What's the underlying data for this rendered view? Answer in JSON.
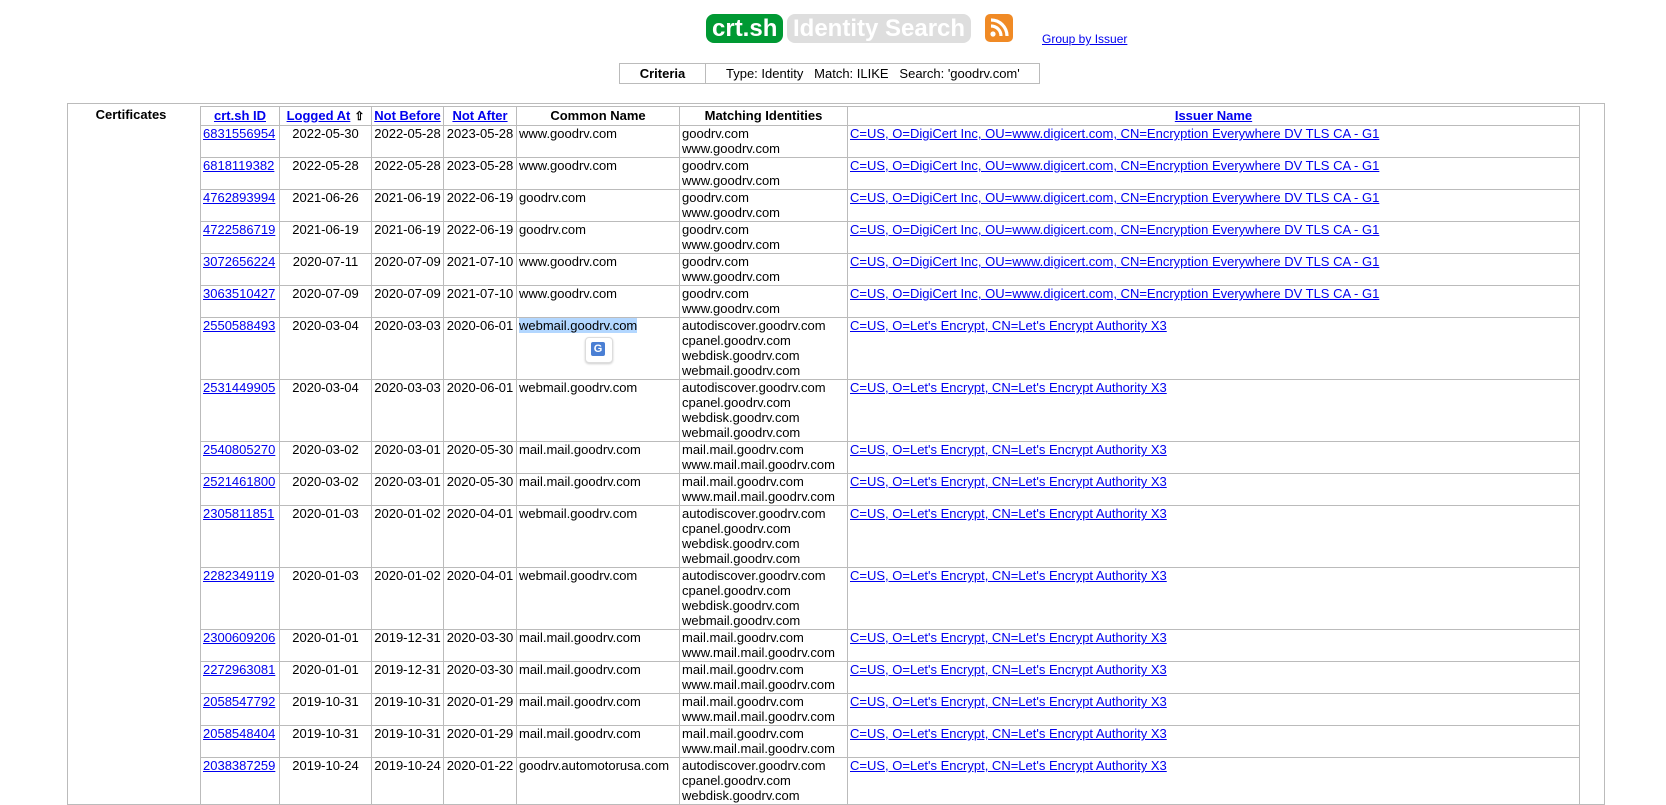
{
  "header": {
    "logo": "crt.sh",
    "title": "Identity Search",
    "rss_icon": "rss-feed-icon",
    "group_by_link": "Group by Issuer"
  },
  "criteria": {
    "label": "Criteria",
    "value": "Type: Identity   Match: ILIKE   Search: 'goodrv.com'"
  },
  "certificates_label": "Certificates",
  "table": {
    "headers": {
      "id": "crt.sh ID",
      "logged_at": "Logged At",
      "sort_icon": "⇧",
      "not_before": "Not Before",
      "not_after": "Not After",
      "common_name": "Common Name",
      "matching": "Matching Identities",
      "issuer": "Issuer Name"
    },
    "rows": [
      {
        "id": "6831556954",
        "logged": "2022-05-30",
        "nb": "2022-05-28",
        "na": "2023-05-28",
        "cn": "www.goodrv.com",
        "mi": "goodrv.com\nwww.goodrv.com",
        "issuer": "C=US, O=DigiCert Inc, OU=www.digicert.com, CN=Encryption Everywhere DV TLS CA - G1"
      },
      {
        "id": "6818119382",
        "logged": "2022-05-28",
        "nb": "2022-05-28",
        "na": "2023-05-28",
        "cn": "www.goodrv.com",
        "mi": "goodrv.com\nwww.goodrv.com",
        "issuer": "C=US, O=DigiCert Inc, OU=www.digicert.com, CN=Encryption Everywhere DV TLS CA - G1"
      },
      {
        "id": "4762893994",
        "logged": "2021-06-26",
        "nb": "2021-06-19",
        "na": "2022-06-19",
        "cn": "goodrv.com",
        "mi": "goodrv.com\nwww.goodrv.com",
        "issuer": "C=US, O=DigiCert Inc, OU=www.digicert.com, CN=Encryption Everywhere DV TLS CA - G1"
      },
      {
        "id": "4722586719",
        "logged": "2021-06-19",
        "nb": "2021-06-19",
        "na": "2022-06-19",
        "cn": "goodrv.com",
        "mi": "goodrv.com\nwww.goodrv.com",
        "issuer": "C=US, O=DigiCert Inc, OU=www.digicert.com, CN=Encryption Everywhere DV TLS CA - G1"
      },
      {
        "id": "3072656224",
        "logged": "2020-07-11",
        "nb": "2020-07-09",
        "na": "2021-07-10",
        "cn": "www.goodrv.com",
        "mi": "goodrv.com\nwww.goodrv.com",
        "issuer": "C=US, O=DigiCert Inc, OU=www.digicert.com, CN=Encryption Everywhere DV TLS CA - G1"
      },
      {
        "id": "3063510427",
        "logged": "2020-07-09",
        "nb": "2020-07-09",
        "na": "2021-07-10",
        "cn": "www.goodrv.com",
        "mi": "goodrv.com\nwww.goodrv.com",
        "issuer": "C=US, O=DigiCert Inc, OU=www.digicert.com, CN=Encryption Everywhere DV TLS CA - G1"
      },
      {
        "id": "2550588493",
        "logged": "2020-03-04",
        "nb": "2020-03-03",
        "na": "2020-06-01",
        "cn": "webmail.goodrv.com",
        "selected": true,
        "mi": "autodiscover.goodrv.com\ncpanel.goodrv.com\nwebdisk.goodrv.com\nwebmail.goodrv.com",
        "issuer": "C=US, O=Let's Encrypt, CN=Let's Encrypt Authority X3"
      },
      {
        "id": "2531449905",
        "logged": "2020-03-04",
        "nb": "2020-03-03",
        "na": "2020-06-01",
        "cn": "webmail.goodrv.com",
        "mi": "autodiscover.goodrv.com\ncpanel.goodrv.com\nwebdisk.goodrv.com\nwebmail.goodrv.com",
        "issuer": "C=US, O=Let's Encrypt, CN=Let's Encrypt Authority X3"
      },
      {
        "id": "2540805270",
        "logged": "2020-03-02",
        "nb": "2020-03-01",
        "na": "2020-05-30",
        "cn": "mail.mail.goodrv.com",
        "mi": "mail.mail.goodrv.com\nwww.mail.mail.goodrv.com",
        "issuer": "C=US, O=Let's Encrypt, CN=Let's Encrypt Authority X3"
      },
      {
        "id": "2521461800",
        "logged": "2020-03-02",
        "nb": "2020-03-01",
        "na": "2020-05-30",
        "cn": "mail.mail.goodrv.com",
        "mi": "mail.mail.goodrv.com\nwww.mail.mail.goodrv.com",
        "issuer": "C=US, O=Let's Encrypt, CN=Let's Encrypt Authority X3"
      },
      {
        "id": "2305811851",
        "logged": "2020-01-03",
        "nb": "2020-01-02",
        "na": "2020-04-01",
        "cn": "webmail.goodrv.com",
        "mi": "autodiscover.goodrv.com\ncpanel.goodrv.com\nwebdisk.goodrv.com\nwebmail.goodrv.com",
        "issuer": "C=US, O=Let's Encrypt, CN=Let's Encrypt Authority X3"
      },
      {
        "id": "2282349119",
        "logged": "2020-01-03",
        "nb": "2020-01-02",
        "na": "2020-04-01",
        "cn": "webmail.goodrv.com",
        "mi": "autodiscover.goodrv.com\ncpanel.goodrv.com\nwebdisk.goodrv.com\nwebmail.goodrv.com",
        "issuer": "C=US, O=Let's Encrypt, CN=Let's Encrypt Authority X3"
      },
      {
        "id": "2300609206",
        "logged": "2020-01-01",
        "nb": "2019-12-31",
        "na": "2020-03-30",
        "cn": "mail.mail.goodrv.com",
        "mi": "mail.mail.goodrv.com\nwww.mail.mail.goodrv.com",
        "issuer": "C=US, O=Let's Encrypt, CN=Let's Encrypt Authority X3"
      },
      {
        "id": "2272963081",
        "logged": "2020-01-01",
        "nb": "2019-12-31",
        "na": "2020-03-30",
        "cn": "mail.mail.goodrv.com",
        "mi": "mail.mail.goodrv.com\nwww.mail.mail.goodrv.com",
        "issuer": "C=US, O=Let's Encrypt, CN=Let's Encrypt Authority X3"
      },
      {
        "id": "2058547792",
        "logged": "2019-10-31",
        "nb": "2019-10-31",
        "na": "2020-01-29",
        "cn": "mail.mail.goodrv.com",
        "mi": "mail.mail.goodrv.com\nwww.mail.mail.goodrv.com",
        "issuer": "C=US, O=Let's Encrypt, CN=Let's Encrypt Authority X3"
      },
      {
        "id": "2058548404",
        "logged": "2019-10-31",
        "nb": "2019-10-31",
        "na": "2020-01-29",
        "cn": "mail.mail.goodrv.com",
        "mi": "mail.mail.goodrv.com\nwww.mail.mail.goodrv.com",
        "issuer": "C=US, O=Let's Encrypt, CN=Let's Encrypt Authority X3"
      },
      {
        "id": "2038387259",
        "logged": "2019-10-24",
        "nb": "2019-10-24",
        "na": "2020-01-22",
        "cn": "goodrv.automotorusa.com",
        "mi": "autodiscover.goodrv.com\ncpanel.goodrv.com\nwebdisk.goodrv.com",
        "issuer": "C=US, O=Let's Encrypt, CN=Let's Encrypt Authority X3"
      }
    ]
  }
}
